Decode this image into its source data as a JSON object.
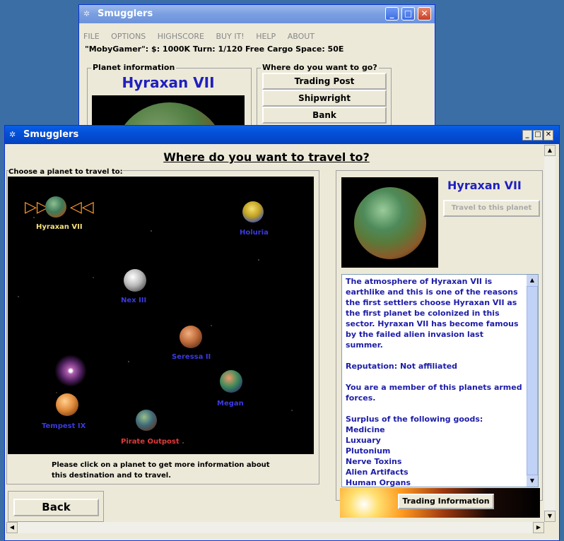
{
  "back_window": {
    "title": "Smugglers",
    "menu": [
      "FILE",
      "OPTIONS",
      "HIGHSCORE",
      "BUY IT!",
      "HELP",
      "ABOUT"
    ],
    "status_line": "\"MobyGamer\": $: 1000K Turn: 1/120 Free Cargo Space: 50E",
    "planet_info_label": "Planet information",
    "planet_name": "Hyraxan VII",
    "where_label": "Where do you want to go?",
    "buttons": [
      "Trading Post",
      "Shipwright",
      "Bank"
    ]
  },
  "front_window": {
    "title": "Smugglers",
    "heading": "Where do you want to travel to?",
    "choose_label": "Choose a planet to travel to:",
    "planets": [
      {
        "name": "Hyraxan VII",
        "color": "#f6e27a"
      },
      {
        "name": "Holuria",
        "color": "#3a3ae0"
      },
      {
        "name": "Nex III",
        "color": "#3a3ae0"
      },
      {
        "name": "Seressa II",
        "color": "#3a3ae0"
      },
      {
        "name": "Megan",
        "color": "#3a3ae0"
      },
      {
        "name": "Tempest IX",
        "color": "#3a3ae0"
      },
      {
        "name": "Pirate Outpost",
        "color": "#e03a3a"
      }
    ],
    "instruction": "Please  click on a planet to get more information about this destination and to travel.",
    "back_button": "Back",
    "selected_planet": "Hyraxan VII",
    "travel_button": "Travel to this planet",
    "description": "The atmosphere of Hyraxan VII is earthlike and this is one of the reasons the first settlers choose Hyraxan VII as the first planet be colonized in this sector. Hyraxan VII has become famous by the failed alien invasion last summer.",
    "reputation": "Reputation: Not affiliated",
    "membership": "You are a member of this planets armed forces.",
    "surplus_heading": "Surplus of the following goods:",
    "goods": [
      "Medicine",
      "Luxuary",
      "Plutonium",
      "Nerve Toxins",
      "Alien Artifacts",
      "Human Organs"
    ],
    "trading_info_button": "Trading Information"
  },
  "colors": {
    "desktop": "#3a6ea5",
    "title_active": "#0450d8",
    "title_inactive": "#7a9ee0",
    "planet_name_blue": "#1f1fbf",
    "info_text": "#1d1da8"
  }
}
